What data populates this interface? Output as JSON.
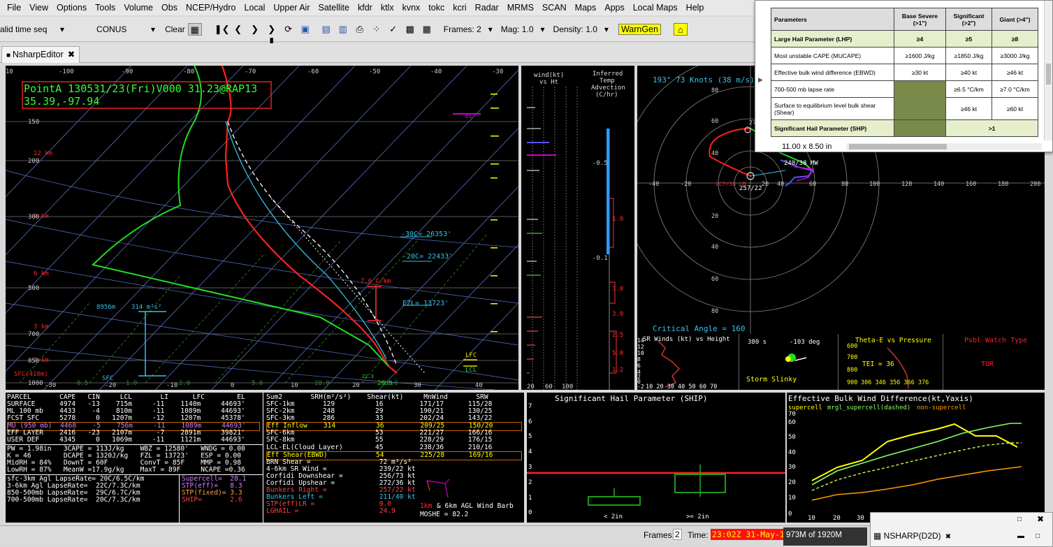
{
  "menu": [
    "File",
    "View",
    "Options",
    "Tools",
    "Volume",
    "Obs",
    "NCEP/Hydro",
    "Local",
    "Upper Air",
    "Satellite",
    "kfdr",
    "ktlx",
    "kvnx",
    "tokc",
    "kcri",
    "Radar",
    "MRMS",
    "SCAN",
    "Maps",
    "Apps",
    "Local Maps",
    "Help"
  ],
  "toolbar": {
    "seq": "alid time seq",
    "area": "CONUS",
    "clear": "Clear",
    "frames": "Frames: 2",
    "mag": "Mag: 1.0",
    "density": "Density: 1.0",
    "warngen": "WarnGen"
  },
  "tab": {
    "label": "NsharpEditor"
  },
  "skewt": {
    "header1": "PointA 130531/23(Fri)V000 31.23@RAP13",
    "header2": "35.39,-97.94",
    "el": "EL",
    "lfc": "LFC",
    "lcl": "LCL",
    "lapse": "7.6 C/km",
    "fzl": "FZL= 13723'",
    "m30": "-30C= 26353'",
    "m20": "-20C= 22433'",
    "srh": "314 m²s²",
    "hgt": "8956m",
    "sfc": "SFC",
    "sfc410": "SFC(410m)",
    "km12": "12 km",
    "km6": "6 km",
    "km3": "3 km",
    "km9": "9 km",
    "km1": "1 km",
    "sfctemp": "20.0",
    "sfcdew": "22.3",
    "p": [
      "150",
      "200",
      "300",
      "500",
      "700",
      "850",
      "1000"
    ],
    "t": [
      "-100",
      "-90",
      "-80",
      "-70",
      "-60",
      "-50",
      "-40",
      "-30",
      "-20",
      "-10",
      "0",
      "10",
      "20",
      "30",
      "40"
    ],
    "mix": [
      "0.5",
      "1.0",
      "2.0",
      "5.0",
      "10.0",
      "20.0"
    ],
    "tl": "10"
  },
  "windpanel": {
    "title1": "wind(kt)",
    "title2": "vs Ht",
    "ticks": [
      "20",
      "60",
      "100"
    ]
  },
  "advect": {
    "title1": "Inferred",
    "title2": "Temp",
    "title3": "Advection",
    "title4": "(C/hr)",
    "vals": [
      "-0.5",
      "1.0",
      "-0.1",
      "3.0",
      "3.0",
      "2.5",
      "5.0",
      "1.2"
    ]
  },
  "hodo": {
    "header": "193°  73 Knots (38 m/s)",
    "critical": "Critical Angle = 160",
    "axes": [
      "-40",
      "-20",
      "20",
      "40",
      "60",
      "80",
      "100",
      "120",
      "140",
      "160",
      "180",
      "200"
    ],
    "yaxes": [
      "80",
      "60",
      "40",
      "20",
      "20",
      "40",
      "60",
      "80"
    ],
    "mw": "240/38 MW",
    "smot": "257/22",
    "lm": "2C7/38 LM",
    "n27": "27"
  },
  "insets": {
    "srwinds": "SR Winds (kt) vs Height",
    "srwinds_x": "10 20 30 40 50 60 70",
    "sr_y": [
      "14",
      "12",
      "10",
      "8",
      "6",
      "4",
      "2",
      "0",
      "-2"
    ],
    "slinky_t": "380 s",
    "slinky_deg": "-103 deg",
    "slinky": "Storm Slinky",
    "thetae": "Theta-E vs Pressure",
    "tei": "TEI = 36",
    "thetae_p": [
      "600",
      "700",
      "800",
      "900"
    ],
    "thetae_x": "306 346 356 366 376",
    "watch": "Psbl Watch Type",
    "watchval": "TOR"
  },
  "parcel": {
    "head": "PARCEL       CAPE   CIN     LCL       LI      LFC        EL",
    "rows": [
      "SURFACE      4974   -13    715m     -11    1140m     44693'",
      "ML 100 mb    4433    -4    810m     -11    1089m     44693'",
      "FCST SFC     5278     0   1207m     -12    1207m     45378'",
      "MU (950 mb)  4468    -5    756m     -11    1089m     44693'",
      "EFF LAYER    2416   -23   2107m      -7    2891m     39821'",
      "USER DEF     4345     0   1069m     -11    1121m     44693'"
    ],
    "misc": [
      "PW = 1.98in   3CAPE = 113J/kg    WBZ = 12580'   WNDG = 0.00",
      "K = 46        DCAPE = 1320J/kg   FZL = 13723'   ESP = 0.00",
      "MidRH = 84%   DownT = 60F        ConvT = 85F    MMP = 0.98",
      "LowRH = 87%   MeanW =17.9g/kg    MaxT = 89F     NCAPE =0.36"
    ],
    "lapse": [
      "sfc-3km Agl LapseRate= 20C/6.5C/km",
      "3-6km Agl LapseRate=  22C/7.3C/km",
      "850-500mb LapseRate=  29C/6.7C/km",
      "700-500mb LapseRate=  20C/7.3C/km"
    ],
    "comp": [
      "Supercell=  28.1",
      "STP(eff)=   8.3",
      "STP(fixed)= 3.3",
      "SHIP=       2.6"
    ]
  },
  "kin": {
    "head": "Sum2       SRH(m²/s²)    Shear(kt)     MnWind       SRW",
    "rows": [
      "SFC-1km       129          16         171/17      115/28",
      "SFC-2km       248          29         190/21      130/25",
      "SFC-3km       286          33         202/24      143/22",
      "Eff Inflow    314          36         209/25      150/20",
      "SFC-6km                    53         221/27      166/16",
      "SFC-8km                    55         228/29      176/15",
      "LCL-EL(Cloud Layer)        45         238/36      210/16",
      "Eff Shear(EBWD)            54         225/28      169/16"
    ],
    "more": [
      "BRN Shear =                 72 m²/s²",
      "4-6km SR Wind =             239/22 kt",
      "Corfidi Downshear =         256/73 kt",
      "Corfidi Upshear =           272/36 kt",
      "Bunkers Right =             257/22 kt",
      "Bunkers Left =              211/40 kt",
      "STP(eff)LR =                0.0",
      "LGHAIL =                    24.9"
    ],
    "barb1": "1km",
    "barb2": "& 6km AGL Wind Barb",
    "moshe": "MOSHE = 82.2"
  },
  "ship": {
    "title": "Significant Hail Parameter (SHIP)",
    "y": [
      "0",
      "1",
      "2",
      "3",
      "4",
      "5",
      "6",
      "7"
    ],
    "c1": "< 2in",
    "c2": ">= 2in"
  },
  "ebwd": {
    "title": "Effective Bulk Wind Difference(kt,Yaxis)",
    "legend1": "supercell",
    "legend2": "mrgl_supercell(dashed)",
    "legend3": "non-supercell",
    "y": [
      "0",
      "10",
      "20",
      "30",
      "40",
      "50",
      "60",
      "70"
    ],
    "x": [
      "10",
      "20",
      "30"
    ]
  },
  "popup": {
    "headers": [
      "Parameters",
      "Base Severe (>1\")",
      "Significant (>2\")",
      "Giant (>4\")"
    ],
    "rows": [
      [
        "Large Hail Parameter (LHP)",
        "≥4",
        "≥5",
        "≥8"
      ],
      [
        "Most unstable CAPE (MUCAPE)",
        "≥1600 J/kg",
        "≥1850 J/kg",
        "≥3000 J/kg"
      ],
      [
        "Effective bulk wind difference (EBWD)",
        "≥30 kt",
        "≥40 kt",
        "≥46 kt"
      ],
      [
        "700-500 mb lapse rate",
        "",
        "≥6.5 °C/km",
        "≥7.0 °C/km"
      ],
      [
        "Surface to equilibrium level bulk shear (Shear)",
        "",
        "≥46 kt",
        "≥60 kt"
      ],
      [
        "Significant Hail Parameter (SHP)",
        "",
        ">1",
        ""
      ]
    ],
    "size": "11.00 x 8.50 in"
  },
  "status": {
    "frames": "Frames:",
    "frames_val": "2",
    "time": "Time:",
    "time_val": "23:02Z 31-May-13",
    "mem": "973M of 1920M",
    "nsharp": "NSHARP(D2D)"
  }
}
